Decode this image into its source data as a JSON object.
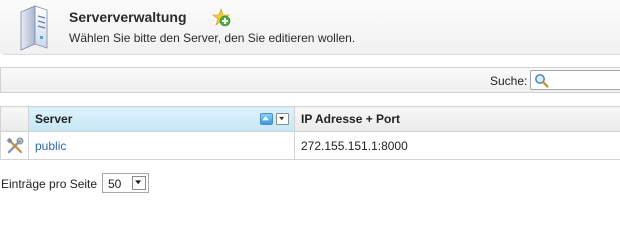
{
  "header": {
    "title": "Serververwaltung",
    "subtitle": "Wählen Sie bitte den Server, den Sie editieren wollen."
  },
  "search": {
    "label": "Suche:",
    "value": "",
    "placeholder": ""
  },
  "table": {
    "columns": [
      {
        "label": "",
        "icon": "tools-icon"
      },
      {
        "label": "Server",
        "sorted": "ascending"
      },
      {
        "label": "IP Adresse + Port"
      }
    ],
    "rows": [
      {
        "server": "public",
        "ip_port": "272.155.151.1:8000",
        "edit_icon": "tools-icon"
      }
    ]
  },
  "footer": {
    "per_page_label": "Einträge pro Seite",
    "per_page_value": "50"
  },
  "colors": {
    "accent": "#2a67b1",
    "sorted_header": "#c5e6f5",
    "border": "#d4d4d4"
  },
  "icons": {
    "header": "server-icon",
    "add": "add-icon",
    "search": "search-icon",
    "sort": "sort-asc-icon",
    "dropdown": "chevron-down-icon"
  }
}
